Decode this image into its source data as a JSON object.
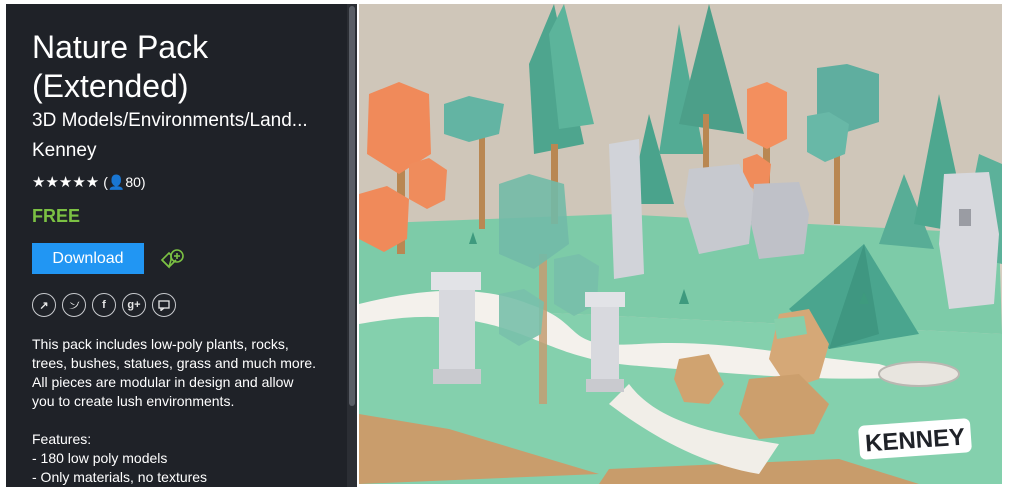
{
  "product": {
    "title_line1": "Nature Pack",
    "title_line2": "(Extended)",
    "category": "3D Models/Environments/Land...",
    "publisher": "Kenney",
    "stars": "★★★★★",
    "rating_count": "(👤80)",
    "price": "FREE",
    "download_label": "Download"
  },
  "description": {
    "paragraph": [
      "This pack includes low-poly plants, rocks,",
      "trees, bushes, statues, grass and much more.",
      "All pieces are modular in design and allow",
      "you to create lush environments."
    ],
    "features_title": "Features:",
    "features": [
      "- 180 low poly models",
      "- Only materials, no textures"
    ]
  },
  "social": [
    "share-icon",
    "twitter-icon",
    "facebook-icon",
    "googleplus-icon",
    "comment-icon"
  ],
  "hero": {
    "logo_text": "KENNEY"
  },
  "colors": {
    "sidebar_bg": "#1f2228",
    "accent": "#2196f3",
    "free": "#7bc143"
  }
}
